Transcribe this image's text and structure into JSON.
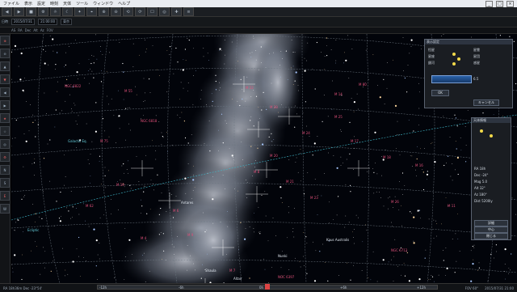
{
  "window": {
    "menu": [
      "ファイル",
      "表示",
      "設定",
      "時刻",
      "天体",
      "ツール",
      "ウィンドウ",
      "ヘルプ"
    ],
    "controls": [
      "_",
      "□",
      "×"
    ]
  },
  "toolbar": {
    "buttons_top": [
      "◀",
      "▶",
      "■",
      "⚙",
      "☼",
      "☾",
      "✦",
      "⌖",
      "⊕",
      "⊖",
      "⟲",
      "⟳",
      "☐",
      "◎",
      "✚",
      "≡"
    ],
    "date_label": "日時",
    "date_value": "2015/07/31",
    "time_value": "21:00:00",
    "location_value": "東京"
  },
  "toolbar3": {
    "items": [
      "AS",
      "RA",
      "Dec",
      "Alt",
      "Az",
      "FOV"
    ]
  },
  "leftbar": {
    "items": [
      "⊕",
      "⊖",
      "▲",
      "▼",
      "◀",
      "▶",
      "★",
      "☆",
      "◎",
      "⚙",
      "N",
      "S",
      "E",
      "W"
    ]
  },
  "sky_labels": [
    {
      "text": "NGC 6822",
      "cls": "lbl-red"
    },
    {
      "text": "M 55",
      "cls": "lbl-red"
    },
    {
      "text": "M 75",
      "cls": "lbl-red"
    },
    {
      "text": "NGC 6818",
      "cls": "lbl-red"
    },
    {
      "text": "M 22",
      "cls": "lbl-red"
    },
    {
      "text": "M 28",
      "cls": "lbl-red"
    },
    {
      "text": "M 8",
      "cls": "lbl-red"
    },
    {
      "text": "M 20",
      "cls": "lbl-red"
    },
    {
      "text": "M 21",
      "cls": "lbl-red"
    },
    {
      "text": "M 23",
      "cls": "lbl-red"
    },
    {
      "text": "M 24",
      "cls": "lbl-red"
    },
    {
      "text": "M 25",
      "cls": "lbl-red"
    },
    {
      "text": "M 17",
      "cls": "lbl-red"
    },
    {
      "text": "M 18",
      "cls": "lbl-red"
    },
    {
      "text": "M 16",
      "cls": "lbl-red"
    },
    {
      "text": "M 26",
      "cls": "lbl-red"
    },
    {
      "text": "M 11",
      "cls": "lbl-red"
    },
    {
      "text": "NGC 6712",
      "cls": "lbl-red"
    },
    {
      "text": "M 14",
      "cls": "lbl-red"
    },
    {
      "text": "M 9",
      "cls": "lbl-red"
    },
    {
      "text": "M 19",
      "cls": "lbl-red"
    },
    {
      "text": "M 62",
      "cls": "lbl-red"
    },
    {
      "text": "M 6",
      "cls": "lbl-red"
    },
    {
      "text": "M 7",
      "cls": "lbl-red"
    },
    {
      "text": "NGC 6397",
      "cls": "lbl-red"
    },
    {
      "text": "M 4",
      "cls": "lbl-red"
    },
    {
      "text": "M 80",
      "cls": "lbl-red"
    },
    {
      "text": "Antares",
      "cls": "lbl-white"
    },
    {
      "text": "Nunki",
      "cls": "lbl-white"
    },
    {
      "text": "Kaus Australis",
      "cls": "lbl-white"
    },
    {
      "text": "Shaula",
      "cls": "lbl-white"
    },
    {
      "text": "Altair",
      "cls": "lbl-white"
    },
    {
      "text": "Ecliptic",
      "cls": "lbl-cyan"
    },
    {
      "text": "Galactic Eq.",
      "cls": "lbl-cyan"
    }
  ],
  "panel_a": {
    "title": "表示設定",
    "labels": [
      "恒星",
      "星座",
      "銀河",
      "星雲",
      "星団",
      "惑星"
    ],
    "button_ok": "OK",
    "button_cancel": "キャンセル",
    "bar_value": "6.5"
  },
  "panel_b": {
    "title": "天体情報",
    "rows": [
      "RA 18h",
      "Dec -24°",
      "Mag 5.0",
      "Alt 32°",
      "Az 180°",
      "Dist 5200ly"
    ],
    "btn1": "詳細",
    "btn2": "中心",
    "btn3": "閉じる"
  },
  "status": {
    "left": "RA 18h36m Dec -23°54'",
    "fov": "FOV 60°",
    "right": "2015/07/31 21:00"
  },
  "timeline": {
    "labels": [
      "-12h",
      "-6h",
      "0h",
      "+6h",
      "+12h"
    ]
  }
}
